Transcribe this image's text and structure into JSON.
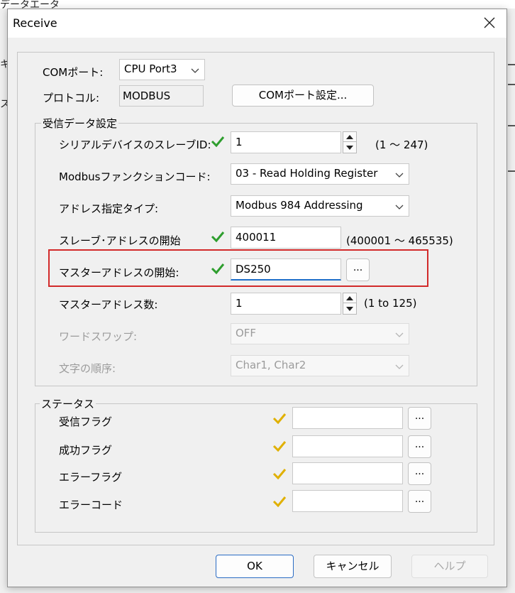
{
  "background": {
    "texts": [
      "データエータ",
      "キ",
      "ス"
    ]
  },
  "dialog": {
    "title": "Receive",
    "com_port": {
      "label": "COMポート:",
      "value": "CPU Port3"
    },
    "protocol": {
      "label": "プロトコル:",
      "value": "MODBUS"
    },
    "com_settings_button": "COMポート設定...",
    "receive_settings": {
      "title": "受信データ設定",
      "slave_id": {
        "label": "シリアルデバイスのスレーブID:",
        "value": "1",
        "range": "(1 ～ 247)"
      },
      "function_code": {
        "label": "Modbusファンクションコード:",
        "value": "03 - Read Holding Register"
      },
      "address_type": {
        "label": "アドレス指定タイプ:",
        "value": "Modbus 984 Addressing"
      },
      "slave_start": {
        "label": "スレーブ･アドレスの開始",
        "value": "400011",
        "range": "(400001 ～ 465535)"
      },
      "master_start": {
        "label": "マスターアドレスの開始:",
        "value": "DS250",
        "browse": "..."
      },
      "master_count": {
        "label": "マスターアドレス数:",
        "value": "1",
        "range": "(1 to 125)"
      },
      "word_swap": {
        "label": "ワードスワップ:",
        "value": "OFF"
      },
      "char_order": {
        "label": "文字の順序:",
        "value": "Char1, Char2"
      }
    },
    "status": {
      "title": "ステータス",
      "rows": [
        {
          "label": "受信フラグ",
          "value": "",
          "browse": "..."
        },
        {
          "label": "成功フラグ",
          "value": "",
          "browse": "..."
        },
        {
          "label": "エラーフラグ",
          "value": "",
          "browse": "..."
        },
        {
          "label": "エラーコード",
          "value": "",
          "browse": "..."
        }
      ]
    },
    "buttons": {
      "ok": "OK",
      "cancel": "キャンセル",
      "help": "ヘルプ"
    }
  },
  "colors": {
    "check_green": "#2e9e2e",
    "check_yellow": "#e0b000",
    "highlight_red": "#d22a2a",
    "focus_blue": "#1f6fc9"
  }
}
